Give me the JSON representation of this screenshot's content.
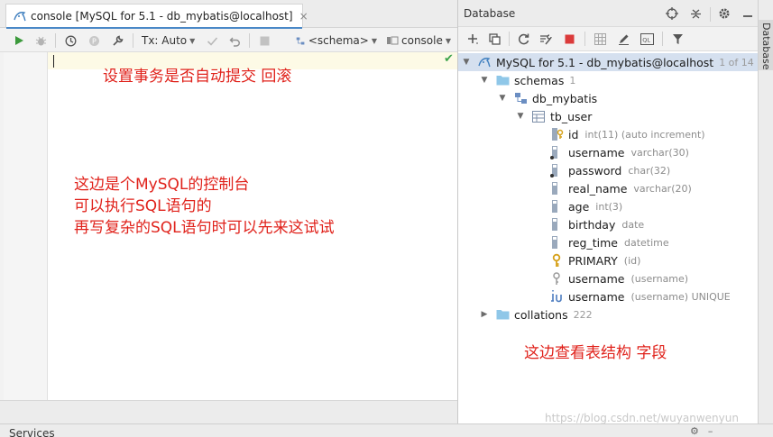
{
  "console": {
    "tab_title": "console [MySQL for 5.1 - db_mybatis@localhost]",
    "close_glyph": "×",
    "tx_label": "Tx: Auto",
    "schema_label": "<schema>",
    "session_label": "console"
  },
  "annotations": {
    "transaction_note": "设置事务是否自动提交 回滚",
    "console_note_lines": [
      "这边是个MySQL的控制台",
      "可以执行SQL语句的",
      "再写复杂的SQL语句时可以先来这试试"
    ],
    "structure_note": "这边查看表结构 字段"
  },
  "database": {
    "panel_title": "Database",
    "side_tab_label": "Database",
    "root": {
      "label": "MySQL for 5.1 - db_mybatis@localhost",
      "count": "1 of 14"
    },
    "schemas": {
      "label": "schemas",
      "count": "1"
    },
    "schema": {
      "label": "db_mybatis"
    },
    "table": {
      "label": "tb_user"
    },
    "columns": [
      {
        "name": "id",
        "type": "int(11) (auto increment)",
        "icon": "primary-key-column-icon"
      },
      {
        "name": "username",
        "type": "varchar(30)",
        "icon": "column-icon"
      },
      {
        "name": "password",
        "type": "char(32)",
        "icon": "column-icon"
      },
      {
        "name": "real_name",
        "type": "varchar(20)",
        "icon": "column-icon"
      },
      {
        "name": "age",
        "type": "int(3)",
        "icon": "column-icon"
      },
      {
        "name": "birthday",
        "type": "date",
        "icon": "column-icon"
      },
      {
        "name": "reg_time",
        "type": "datetime",
        "icon": "column-icon"
      }
    ],
    "keys": [
      {
        "name": "PRIMARY",
        "detail": "(id)",
        "icon": "primary-key-icon"
      },
      {
        "name": "username",
        "detail": "(username)",
        "icon": "index-icon"
      },
      {
        "name": "username",
        "detail": "(username) UNIQUE",
        "icon": "unique-index-icon"
      }
    ],
    "collations": {
      "label": "collations",
      "count": "222"
    }
  },
  "status_bar": {
    "services_label": "Services"
  },
  "watermark": "https://blog.csdn.net/wuyanwenyun",
  "colors": {
    "accent": "#4a88c7",
    "annotation": "#e0221b",
    "selection": "#d5e0ef"
  }
}
